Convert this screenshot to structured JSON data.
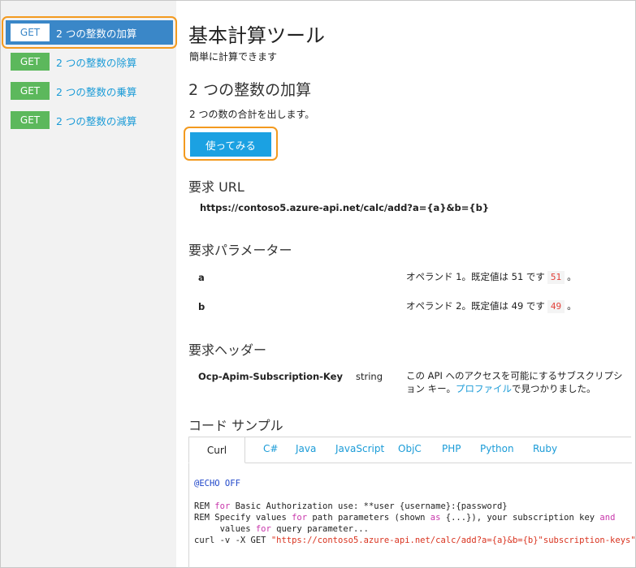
{
  "sidebar": {
    "operations": [
      {
        "verb": "GET",
        "name": "2 つの整数の加算"
      },
      {
        "verb": "GET",
        "name": "2 つの整数の除算"
      },
      {
        "verb": "GET",
        "name": "2 つの整数の乗算"
      },
      {
        "verb": "GET",
        "name": "2 つの整数の減算"
      }
    ]
  },
  "api": {
    "title": "基本計算ツール",
    "subtitle": "簡単に計算できます"
  },
  "operation": {
    "title": "2 つの整数の加算",
    "description": "2 つの数の合計を出します。",
    "try_label": "使ってみる"
  },
  "request_url": {
    "heading": "要求 URL",
    "url": "https://contoso5.azure-api.net/calc/add?a={a}&b={b}"
  },
  "request_params": {
    "heading": "要求パラメーター",
    "params": [
      {
        "name": "a",
        "desc_before": "オペランド 1。既定値は 51 です",
        "value": "51",
        "desc_after": "。"
      },
      {
        "name": "b",
        "desc_before": "オペランド 2。既定値は 49 です",
        "value": "49",
        "desc_after": "。"
      }
    ]
  },
  "request_headers": {
    "heading": "要求ヘッダー",
    "header": {
      "name": "Ocp-Apim-Subscription-Key",
      "type": "string",
      "desc_before": "この API へのアクセスを可能にするサブスクリプション キー。",
      "link": "プロファイル",
      "desc_after": "で見つかりました。"
    }
  },
  "code_samples": {
    "heading": "コード サンプル",
    "tabs": [
      "Curl",
      "C#",
      "Java",
      "JavaScript",
      "ObjC",
      "PHP",
      "Python",
      "Ruby"
    ],
    "active_tab": "Curl",
    "lines": {
      "echo": "@ECHO OFF",
      "l1_a": "REM ",
      "l1_kw": "for",
      "l1_b": " Basic Authorization use: **user {username}:{password}",
      "l2_a": "REM Specify values ",
      "l2_kw1": "for",
      "l2_b": " path parameters (shown ",
      "l2_kw2": "as",
      "l2_c": " {...}), your subscription key ",
      "l2_kw3": "and",
      "l3_a": "     values ",
      "l3_kw": "for",
      "l3_b": " query parameter...",
      "l4_a": "curl -v -X GET ",
      "l4_str": "\"https://contoso5.azure-api.net/calc/add?a={a}&b={b}\"subscription-keys\""
    }
  },
  "colors": {
    "accent": "#1ba1e2",
    "verb_get": "#5cb85c",
    "active_op": "#3a87c8",
    "highlight": "#f39a1f"
  }
}
